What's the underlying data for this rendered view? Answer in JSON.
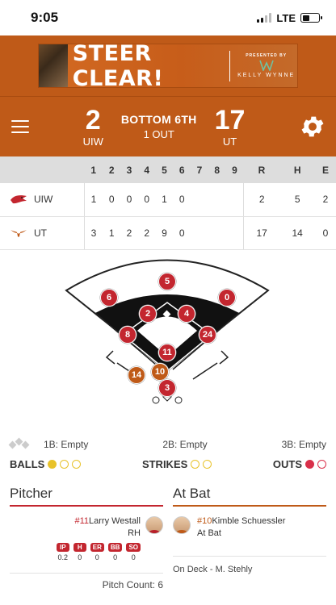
{
  "status_bar": {
    "time": "9:05",
    "network": "LTE"
  },
  "ad": {
    "title": "STEER CLEAR!",
    "presented_by": "PRESENTED BY",
    "brand": "KELLY WYNNE"
  },
  "scoreboard": {
    "away": {
      "runs": "2",
      "abbr": "UIW"
    },
    "home": {
      "runs": "17",
      "abbr": "UT"
    },
    "half_inning": "BOTTOM 6TH",
    "outs_text": "1 OUT"
  },
  "linescore": {
    "columns": [
      "1",
      "2",
      "3",
      "4",
      "5",
      "6",
      "7",
      "8",
      "9",
      "R",
      "H",
      "E"
    ],
    "rows": [
      {
        "team": "UIW",
        "innings": [
          "1",
          "0",
          "0",
          "0",
          "1",
          "0",
          "",
          "",
          ""
        ],
        "r": "2",
        "h": "5",
        "e": "2"
      },
      {
        "team": "UT",
        "innings": [
          "3",
          "1",
          "2",
          "2",
          "9",
          "0",
          "",
          "",
          ""
        ],
        "r": "17",
        "h": "14",
        "e": "0"
      }
    ]
  },
  "field": {
    "positions": {
      "cf": "5",
      "lf": "6",
      "rf": "0",
      "ss": "2",
      "b2": "4",
      "b3": "8",
      "b1": "24",
      "p": "11",
      "c": "3"
    },
    "batter": "10",
    "runner": "14"
  },
  "bases": {
    "first": "1B: Empty",
    "second": "2B: Empty",
    "third": "3B: Empty"
  },
  "count": {
    "balls_label": "BALLS",
    "strikes_label": "STRIKES",
    "outs_label": "OUTS",
    "balls": 1,
    "strikes": 0,
    "outs": 1
  },
  "pitcher": {
    "heading": "Pitcher",
    "number": "#11",
    "name": "Larry Westall",
    "hand": "RH",
    "stats": [
      {
        "label": "IP",
        "value": "0.2"
      },
      {
        "label": "H",
        "value": "0"
      },
      {
        "label": "ER",
        "value": "0"
      },
      {
        "label": "BB",
        "value": "0"
      },
      {
        "label": "SO",
        "value": "0"
      }
    ],
    "pitch_count": "Pitch Count: 6"
  },
  "at_bat": {
    "heading": "At Bat",
    "number": "#10",
    "name": "Kimble Schuessler",
    "status": "At Bat",
    "on_deck": "On Deck - M. Stehly"
  },
  "colors": {
    "burnt_orange": "#bf5a18",
    "cardinal": "#c3262f",
    "ball_yellow": "#e8c22a",
    "out_red": "#d9304a"
  }
}
